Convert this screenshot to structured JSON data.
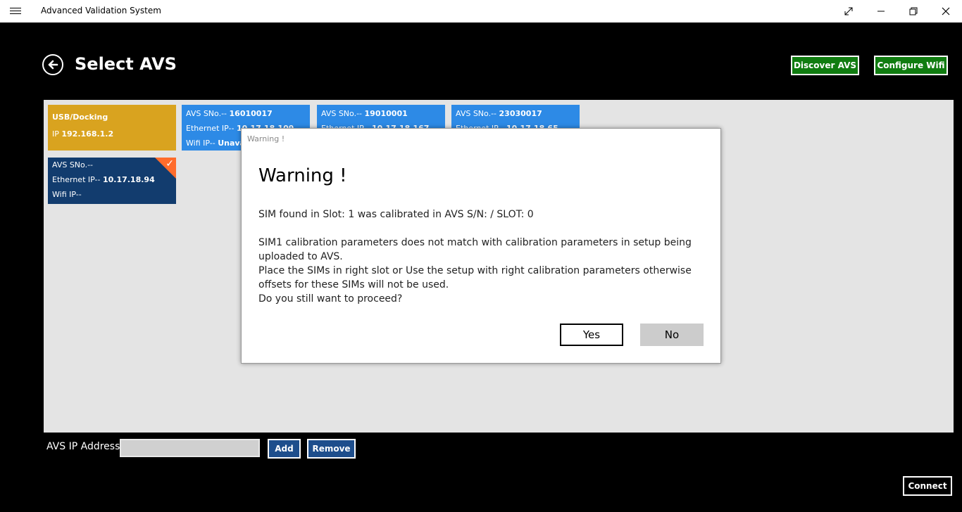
{
  "window": {
    "title": "Advanced Validation System",
    "controls": {
      "fullscreen_icon": "expand-icon",
      "minimize": "—",
      "restore": "❐",
      "close": "✕"
    }
  },
  "header": {
    "title": "Select AVS",
    "discover_label": "Discover AVS",
    "configure_label": "Configure Wifi"
  },
  "devices": [
    {
      "line1": "USB/Docking",
      "ip_prefix": "IP ",
      "ip": "192.168.1.2"
    },
    {
      "sn_prefix": "AVS SNo.-- ",
      "sn": "16010017",
      "eth_prefix": "Ethernet IP-- ",
      "eth": "10.17.18.109",
      "wifi_prefix": "Wifi IP-- ",
      "wifi": "Unavailable"
    },
    {
      "sn_prefix": "AVS SNo.-- ",
      "sn": "19010001",
      "eth_prefix": "Ethernet IP-- ",
      "eth": "10.17.18.167"
    },
    {
      "sn_prefix": "AVS SNo.-- ",
      "sn": "23030017",
      "eth_prefix": "Ethernet IP-- ",
      "eth": "10.17.18.65"
    },
    {
      "sn_prefix": "AVS SNo.--",
      "sn": "",
      "eth_prefix": "Ethernet IP-- ",
      "eth": "10.17.18.94",
      "wifi_prefix": "Wifi IP--",
      "wifi": "",
      "selected": true
    }
  ],
  "footer": {
    "ip_label": "AVS IP Address",
    "ip_value": "",
    "add_label": "Add",
    "remove_label": "Remove",
    "connect_label": "Connect"
  },
  "dialog": {
    "caption": "Warning !",
    "heading": "Warning !",
    "line1": "SIM found in Slot: 1  was calibrated in AVS S/N: / SLOT: 0",
    "line2": "SIM1 calibration parameters does not match with calibration parameters in setup being uploaded to AVS.",
    "line3": "Place the SIMs in right slot or Use the setup with right calibration parameters otherwise offsets for these SIMs will not be used.",
    "line4": "Do you still want to proceed?",
    "yes_label": "Yes",
    "no_label": "No"
  }
}
